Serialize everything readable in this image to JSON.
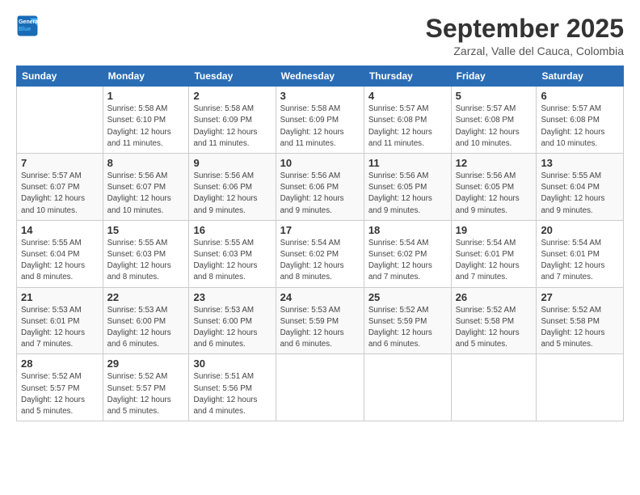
{
  "logo": {
    "line1": "General",
    "line2": "Blue"
  },
  "title": "September 2025",
  "location": "Zarzal, Valle del Cauca, Colombia",
  "weekdays": [
    "Sunday",
    "Monday",
    "Tuesday",
    "Wednesday",
    "Thursday",
    "Friday",
    "Saturday"
  ],
  "weeks": [
    [
      {
        "day": null,
        "info": null
      },
      {
        "day": "1",
        "info": "Sunrise: 5:58 AM\nSunset: 6:10 PM\nDaylight: 12 hours\nand 11 minutes."
      },
      {
        "day": "2",
        "info": "Sunrise: 5:58 AM\nSunset: 6:09 PM\nDaylight: 12 hours\nand 11 minutes."
      },
      {
        "day": "3",
        "info": "Sunrise: 5:58 AM\nSunset: 6:09 PM\nDaylight: 12 hours\nand 11 minutes."
      },
      {
        "day": "4",
        "info": "Sunrise: 5:57 AM\nSunset: 6:08 PM\nDaylight: 12 hours\nand 11 minutes."
      },
      {
        "day": "5",
        "info": "Sunrise: 5:57 AM\nSunset: 6:08 PM\nDaylight: 12 hours\nand 10 minutes."
      },
      {
        "day": "6",
        "info": "Sunrise: 5:57 AM\nSunset: 6:08 PM\nDaylight: 12 hours\nand 10 minutes."
      }
    ],
    [
      {
        "day": "7",
        "info": "Sunrise: 5:57 AM\nSunset: 6:07 PM\nDaylight: 12 hours\nand 10 minutes."
      },
      {
        "day": "8",
        "info": "Sunrise: 5:56 AM\nSunset: 6:07 PM\nDaylight: 12 hours\nand 10 minutes."
      },
      {
        "day": "9",
        "info": "Sunrise: 5:56 AM\nSunset: 6:06 PM\nDaylight: 12 hours\nand 9 minutes."
      },
      {
        "day": "10",
        "info": "Sunrise: 5:56 AM\nSunset: 6:06 PM\nDaylight: 12 hours\nand 9 minutes."
      },
      {
        "day": "11",
        "info": "Sunrise: 5:56 AM\nSunset: 6:05 PM\nDaylight: 12 hours\nand 9 minutes."
      },
      {
        "day": "12",
        "info": "Sunrise: 5:56 AM\nSunset: 6:05 PM\nDaylight: 12 hours\nand 9 minutes."
      },
      {
        "day": "13",
        "info": "Sunrise: 5:55 AM\nSunset: 6:04 PM\nDaylight: 12 hours\nand 9 minutes."
      }
    ],
    [
      {
        "day": "14",
        "info": "Sunrise: 5:55 AM\nSunset: 6:04 PM\nDaylight: 12 hours\nand 8 minutes."
      },
      {
        "day": "15",
        "info": "Sunrise: 5:55 AM\nSunset: 6:03 PM\nDaylight: 12 hours\nand 8 minutes."
      },
      {
        "day": "16",
        "info": "Sunrise: 5:55 AM\nSunset: 6:03 PM\nDaylight: 12 hours\nand 8 minutes."
      },
      {
        "day": "17",
        "info": "Sunrise: 5:54 AM\nSunset: 6:02 PM\nDaylight: 12 hours\nand 8 minutes."
      },
      {
        "day": "18",
        "info": "Sunrise: 5:54 AM\nSunset: 6:02 PM\nDaylight: 12 hours\nand 7 minutes."
      },
      {
        "day": "19",
        "info": "Sunrise: 5:54 AM\nSunset: 6:01 PM\nDaylight: 12 hours\nand 7 minutes."
      },
      {
        "day": "20",
        "info": "Sunrise: 5:54 AM\nSunset: 6:01 PM\nDaylight: 12 hours\nand 7 minutes."
      }
    ],
    [
      {
        "day": "21",
        "info": "Sunrise: 5:53 AM\nSunset: 6:01 PM\nDaylight: 12 hours\nand 7 minutes."
      },
      {
        "day": "22",
        "info": "Sunrise: 5:53 AM\nSunset: 6:00 PM\nDaylight: 12 hours\nand 6 minutes."
      },
      {
        "day": "23",
        "info": "Sunrise: 5:53 AM\nSunset: 6:00 PM\nDaylight: 12 hours\nand 6 minutes."
      },
      {
        "day": "24",
        "info": "Sunrise: 5:53 AM\nSunset: 5:59 PM\nDaylight: 12 hours\nand 6 minutes."
      },
      {
        "day": "25",
        "info": "Sunrise: 5:52 AM\nSunset: 5:59 PM\nDaylight: 12 hours\nand 6 minutes."
      },
      {
        "day": "26",
        "info": "Sunrise: 5:52 AM\nSunset: 5:58 PM\nDaylight: 12 hours\nand 5 minutes."
      },
      {
        "day": "27",
        "info": "Sunrise: 5:52 AM\nSunset: 5:58 PM\nDaylight: 12 hours\nand 5 minutes."
      }
    ],
    [
      {
        "day": "28",
        "info": "Sunrise: 5:52 AM\nSunset: 5:57 PM\nDaylight: 12 hours\nand 5 minutes."
      },
      {
        "day": "29",
        "info": "Sunrise: 5:52 AM\nSunset: 5:57 PM\nDaylight: 12 hours\nand 5 minutes."
      },
      {
        "day": "30",
        "info": "Sunrise: 5:51 AM\nSunset: 5:56 PM\nDaylight: 12 hours\nand 4 minutes."
      },
      {
        "day": null,
        "info": null
      },
      {
        "day": null,
        "info": null
      },
      {
        "day": null,
        "info": null
      },
      {
        "day": null,
        "info": null
      }
    ]
  ]
}
